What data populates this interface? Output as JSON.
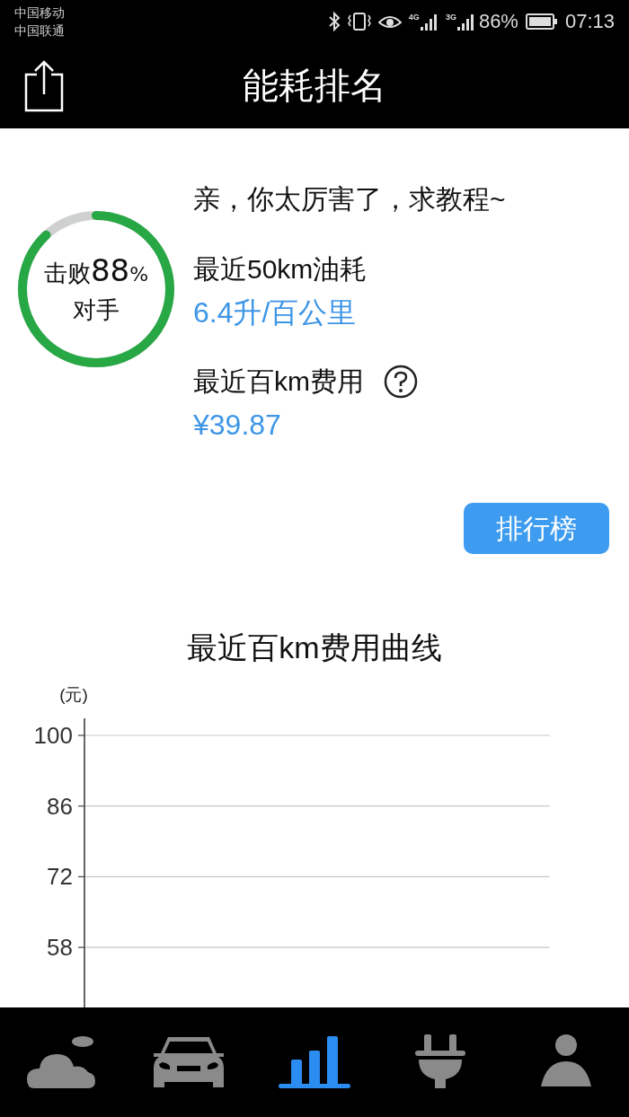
{
  "status_bar": {
    "carriers": [
      "中国移动",
      "中国联通"
    ],
    "network_1": "4G",
    "network_2": "3G",
    "battery": "86%",
    "time": "07:13"
  },
  "header": {
    "title": "能耗排名"
  },
  "ranking": {
    "prefix": "击败",
    "percent": "88",
    "percent_sign": "%",
    "suffix": "对手"
  },
  "summary": {
    "headline": "亲，你太厉害了，求教程~",
    "stats": [
      {
        "label": "最近50km油耗",
        "value": "6.4升/百公里",
        "help": false
      },
      {
        "label": "最近百km费用",
        "value": "¥39.87",
        "help": true
      }
    ]
  },
  "leaderboard_button": "排行榜",
  "chart": {
    "title": "最近百km费用曲线",
    "unit": "(元)",
    "y_labels": [
      "100",
      "86",
      "72",
      "58"
    ]
  },
  "tab_bar": [
    {
      "kind": "cloud",
      "selected": false
    },
    {
      "kind": "car",
      "selected": false
    },
    {
      "kind": "stats",
      "selected": true
    },
    {
      "kind": "plug",
      "selected": false
    },
    {
      "kind": "profile",
      "selected": false
    }
  ]
}
